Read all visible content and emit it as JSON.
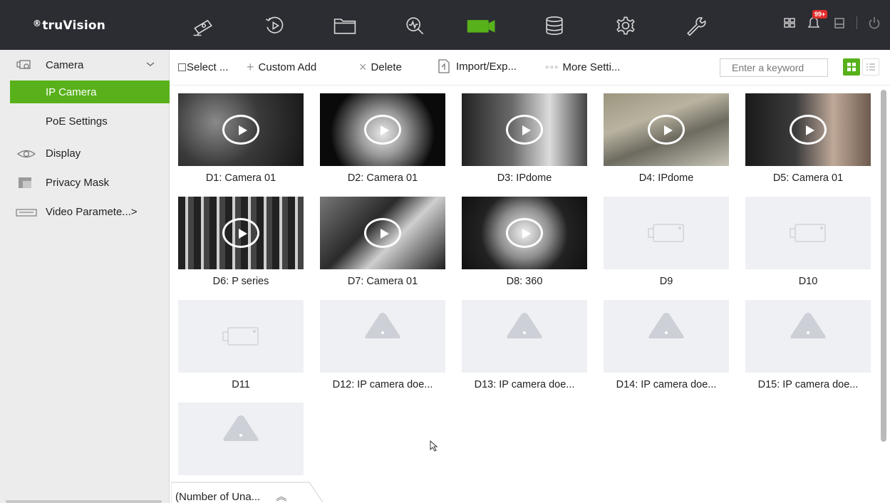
{
  "app": {
    "brand": "truVision",
    "brand_mark": "®",
    "notification_badge": "99+"
  },
  "nav": {
    "icons": [
      "camera-icon",
      "playback-icon",
      "file-icon",
      "search-icon",
      "live-camera-icon",
      "database-icon",
      "settings-icon",
      "tools-icon"
    ],
    "active": "live-camera-icon",
    "accent": "#58b11a"
  },
  "sidebar": {
    "camera_label": "Camera",
    "ip_camera_label": "IP Camera",
    "poe_label": "PoE Settings",
    "display_label": "Display",
    "privacy_label": "Privacy Mask",
    "video_label": "Video Paramete...>"
  },
  "toolbar": {
    "select_label": "Select ...",
    "custom_add_label": "Custom Add",
    "delete_label": "Delete",
    "import_label": "Import/Exp...",
    "more_label": "More Setti...",
    "search_placeholder": "Enter a keyword"
  },
  "cameras": [
    {
      "label": "D1: Camera 01",
      "state": "live"
    },
    {
      "label": "D2: Camera 01",
      "state": "live"
    },
    {
      "label": "D3: IPdome",
      "state": "live"
    },
    {
      "label": "D4: IPdome",
      "state": "live"
    },
    {
      "label": "D5: Camera 01",
      "state": "live"
    },
    {
      "label": "D6: P series",
      "state": "live"
    },
    {
      "label": "D7: Camera 01",
      "state": "live"
    },
    {
      "label": "D8: 360",
      "state": "live"
    },
    {
      "label": "D9",
      "state": "empty"
    },
    {
      "label": "D10",
      "state": "empty"
    },
    {
      "label": "D11",
      "state": "empty"
    },
    {
      "label": "D12: IP camera doe...",
      "state": "warning"
    },
    {
      "label": "D13: IP camera doe...",
      "state": "warning"
    },
    {
      "label": "D14: IP camera doe...",
      "state": "warning"
    },
    {
      "label": "D15: IP camera doe...",
      "state": "warning"
    },
    {
      "label": "",
      "state": "warning"
    }
  ],
  "footer": {
    "tab_label": "(Number of Una..."
  }
}
